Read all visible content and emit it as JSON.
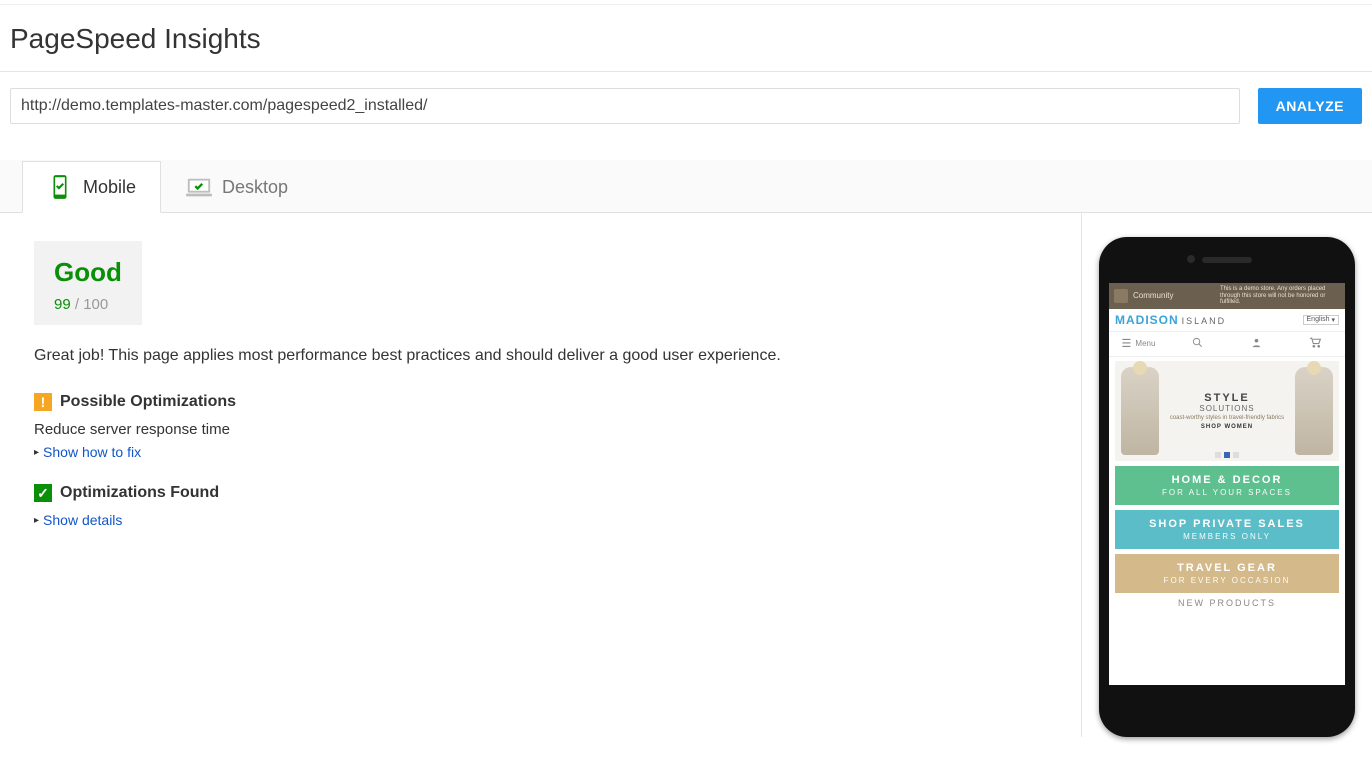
{
  "header": {
    "title": "PageSpeed Insights"
  },
  "controls": {
    "url": "http://demo.templates-master.com/pagespeed2_installed/",
    "analyze_label": "ANALYZE"
  },
  "tabs": {
    "mobile": "Mobile",
    "desktop": "Desktop"
  },
  "score": {
    "label": "Good",
    "value": "99",
    "sep": " / ",
    "max": "100"
  },
  "summary": "Great job! This page applies most performance best practices and should deliver a good user experience.",
  "sections": {
    "possible": {
      "title": "Possible Optimizations",
      "badge": "!",
      "item": "Reduce server response time",
      "link": "Show how to fix"
    },
    "found": {
      "title": "Optimizations Found",
      "badge": "✓",
      "link": "Show details"
    }
  },
  "preview": {
    "community": "Community",
    "demo_note": "This is a demo store. Any orders placed through this store will not be honored or fulfilled.",
    "brand": "MADISON",
    "brand_sub": "ISLAND",
    "lang": "English",
    "menu": "Menu",
    "hero": {
      "t1": "STYLE",
      "t2": "SOLUTIONS",
      "t3": "coast-worthy styles in travel-friendly fabrics",
      "t4": "SHOP WOMEN"
    },
    "promos": [
      {
        "p1": "HOME & DECOR",
        "p2": "FOR ALL YOUR SPACES"
      },
      {
        "p1": "SHOP PRIVATE SALES",
        "p2": "MEMBERS ONLY"
      },
      {
        "p1": "TRAVEL GEAR",
        "p2": "FOR EVERY OCCASION"
      }
    ],
    "new_products": "NEW PRODUCTS"
  }
}
